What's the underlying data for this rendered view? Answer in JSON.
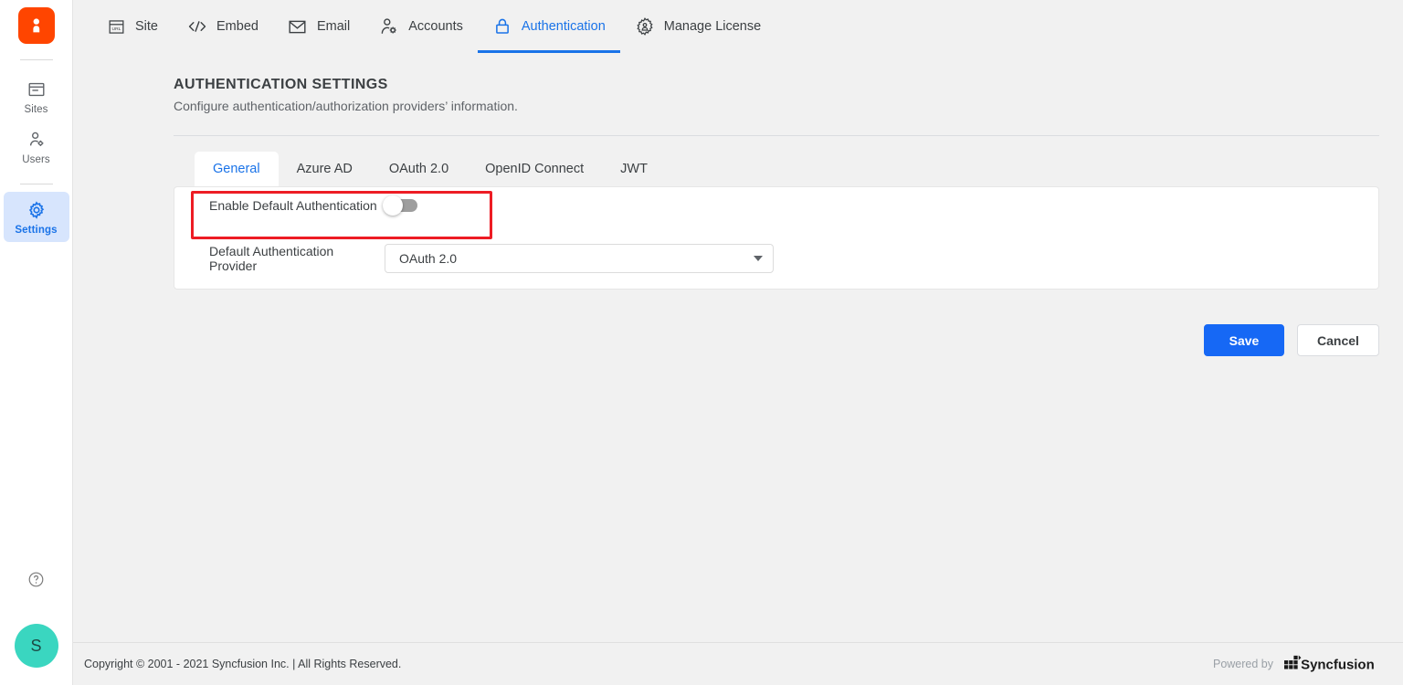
{
  "rail": {
    "logo_icon": "boldbi-logo-icon",
    "logo_letter": "B",
    "items": [
      {
        "label": "Sites",
        "icon": "sites-icon",
        "active": false
      },
      {
        "label": "Users",
        "icon": "users-icon",
        "active": false
      },
      {
        "label": "Settings",
        "icon": "gear-icon",
        "active": true
      }
    ],
    "help_icon": "help-circle-icon",
    "avatar_initial": "S"
  },
  "topnav": {
    "items": [
      {
        "label": "Site",
        "icon": "url-window-icon",
        "active": false
      },
      {
        "label": "Embed",
        "icon": "code-brackets-icon",
        "active": false
      },
      {
        "label": "Email",
        "icon": "envelope-icon",
        "active": false
      },
      {
        "label": "Accounts",
        "icon": "person-gear-icon",
        "active": false
      },
      {
        "label": "Authentication",
        "icon": "lock-icon",
        "active": true
      },
      {
        "label": "Manage License",
        "icon": "gear-person-icon",
        "active": false
      }
    ]
  },
  "header": {
    "title": "AUTHENTICATION SETTINGS",
    "subtitle": "Configure authentication/authorization providers’ information."
  },
  "tabs": [
    {
      "label": "General",
      "active": true
    },
    {
      "label": "Azure AD",
      "active": false
    },
    {
      "label": "OAuth 2.0",
      "active": false
    },
    {
      "label": "OpenID Connect",
      "active": false
    },
    {
      "label": "JWT",
      "active": false
    }
  ],
  "form": {
    "enable_default_auth": {
      "label": "Enable Default Authentication",
      "toggle_state": "off",
      "highlighted": true
    },
    "default_provider": {
      "label": "Default Authentication Provider",
      "value": "OAuth 2.0",
      "caret_icon": "chevron-down-icon"
    }
  },
  "actions": {
    "save_label": "Save",
    "cancel_label": "Cancel"
  },
  "footer": {
    "copyright": "Copyright © 2001 - 2021 Syncfusion Inc. | All Rights Reserved.",
    "powered_by": "Powered by",
    "brand": "Syncfusion"
  },
  "colors": {
    "accent_blue": "#1a73e8",
    "save_blue": "#1668f5",
    "brand_orange": "#ff4500",
    "avatar_teal": "#3ad6c0",
    "highlight_red": "#ed1c24",
    "active_rail_bg": "#d7e5fd",
    "page_bg": "#f1f1f1"
  }
}
